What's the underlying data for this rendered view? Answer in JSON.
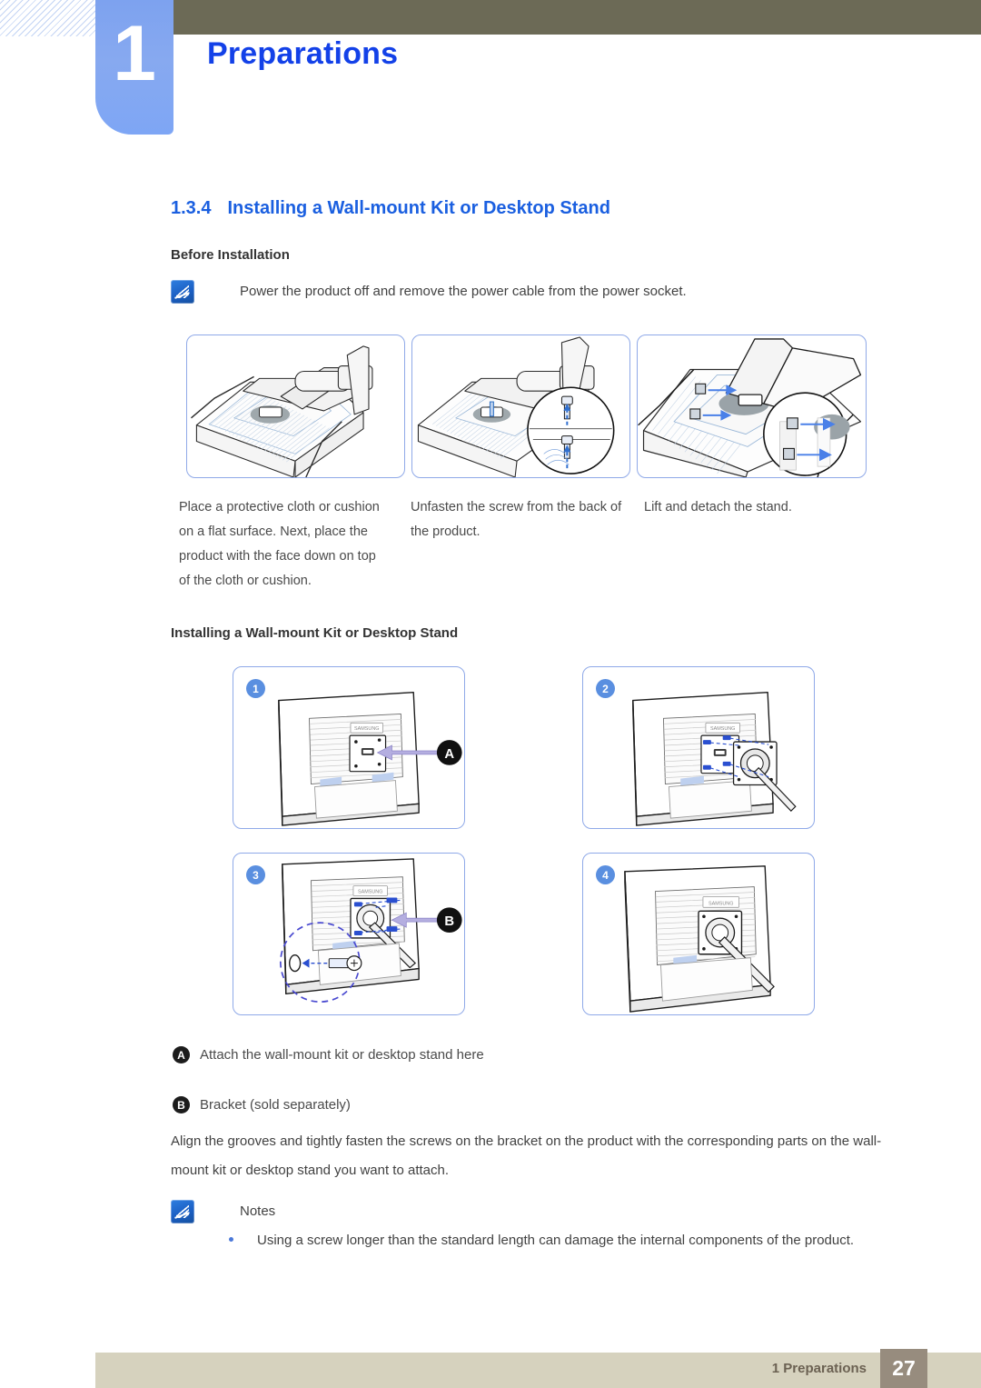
{
  "header": {
    "chapter_number": "1",
    "chapter_title": "Preparations",
    "olive_bar_color": "#6c6a56",
    "tab_color": "#7ea6f5",
    "title_color": "#1341e8"
  },
  "section": {
    "number": "1.3.4",
    "title": "Installing a Wall-mount Kit or Desktop Stand",
    "heading_color": "#1a5fe0",
    "before_installation_heading": "Before Installation",
    "before_installation_note": "Power the product off and remove the power cable from the power socket.",
    "note_icon": "note-pen-icon"
  },
  "top_steps": {
    "panels": [
      {
        "illustration": "monitor-face-down-on-cushion-with-stand",
        "caption": "Place a protective cloth or cushion on a flat surface. Next, place the product with the face down on top of the cloth or cushion."
      },
      {
        "illustration": "unfasten-screw-magnified-detail",
        "caption": "Unfasten the screw from the back of the product."
      },
      {
        "illustration": "lift-and-detach-stand-arrows",
        "caption": "Lift and detach the stand."
      }
    ]
  },
  "install_section": {
    "heading": "Installing a Wall-mount Kit or Desktop Stand",
    "panels": [
      {
        "step": "1",
        "illustration": "monitor-back-vesa-plate-marker-a",
        "marker": "A"
      },
      {
        "step": "2",
        "illustration": "bracket-aligned-with-screws",
        "marker": ""
      },
      {
        "step": "3",
        "illustration": "bracket-fastened-marker-b-screw-detail",
        "marker": "B"
      },
      {
        "step": "4",
        "illustration": "bracket-attached-complete",
        "marker": ""
      }
    ]
  },
  "legend": [
    {
      "tag": "A",
      "text": "Attach the wall-mount kit or desktop stand here"
    },
    {
      "tag": "B",
      "text": "Bracket (sold separately)"
    }
  ],
  "body_paragraph": "Align the grooves and tightly fasten the screws on the bracket on the product with the corresponding parts on the wall-mount kit or desktop stand you want to attach.",
  "notes": {
    "heading": "Notes",
    "icon": "note-pen-icon",
    "items": [
      "Using a screw longer than the standard length can damage the internal components of the product."
    ]
  },
  "footer": {
    "label": "1 Preparations",
    "page_number": "27",
    "bar_color": "#d6d2be",
    "page_box_color": "#978c7e"
  }
}
